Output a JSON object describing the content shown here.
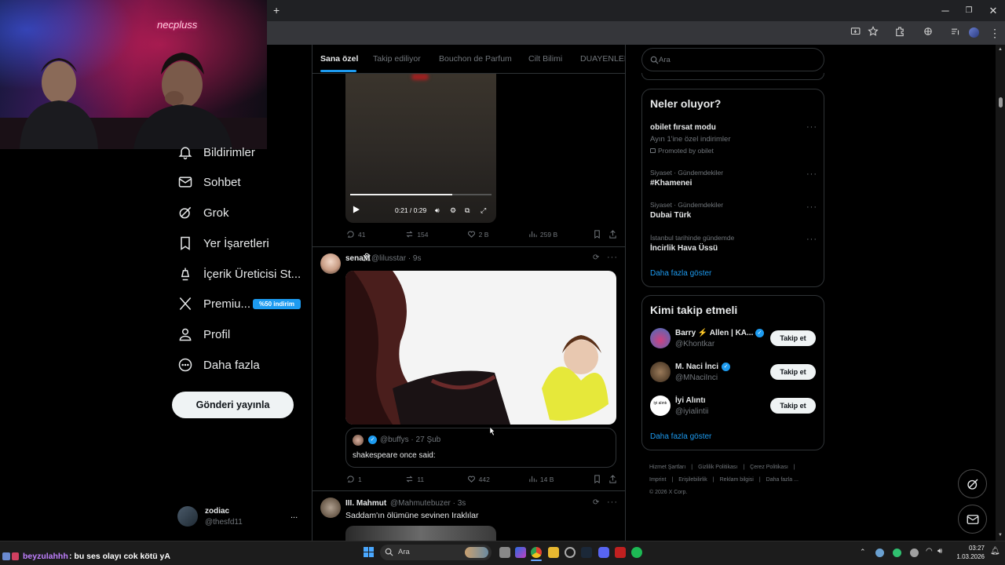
{
  "browser": {
    "new_tab": "+",
    "minimize": "─",
    "restore": "❐",
    "close": "✕"
  },
  "overlay": {
    "logo": "necpluss",
    "chat_user": "beyzulahhh",
    "chat_message": ": bu ses olayı cok kötü yA"
  },
  "sidebar": {
    "items": [
      {
        "label": "Bildirimler",
        "icon": "bell-icon"
      },
      {
        "label": "Sohbet",
        "icon": "mail-icon"
      },
      {
        "label": "Grok",
        "icon": "grok-icon"
      },
      {
        "label": "Yer İşaretleri",
        "icon": "bookmark-icon"
      },
      {
        "label": "İçerik Üreticisi St...",
        "icon": "creator-studio-icon"
      },
      {
        "label": "Premiu...",
        "icon": "x-logo-icon",
        "badge": "%50 indirim"
      },
      {
        "label": "Profil",
        "icon": "person-icon"
      },
      {
        "label": "Daha fazla",
        "icon": "more-circle-icon"
      }
    ],
    "post_button": "Gönderi yayınla",
    "account": {
      "name": "zodiac",
      "handle": "@thesfd11",
      "more": "..."
    }
  },
  "feed": {
    "tabs": [
      "Sana özel",
      "Takip ediliyor",
      "Bouchon de Parfum",
      "Cilt Bilimi",
      "DUAYENLER"
    ],
    "video": {
      "time": "0:21 / 0:29",
      "progress": 0.72
    },
    "post1_stats": {
      "replies": "41",
      "reposts": "154",
      "likes": "2 B",
      "views": "259 B"
    },
    "post2": {
      "name": "sena🕅",
      "handle": "@lilusstar · 9s",
      "quote": {
        "handle": "@buffys · 27 Şub",
        "text": "shakespeare once said:"
      },
      "stats": {
        "replies": "1",
        "reposts": "11",
        "likes": "442",
        "views": "14 B"
      }
    },
    "post3": {
      "name": "III. Mahmut",
      "handle": "@Mahmutebuzer · 3s",
      "text": "Saddam'ın ölümüne sevinen Iraklılar"
    }
  },
  "right": {
    "search_placeholder": "Ara",
    "trends_title": "Neler oluyor?",
    "trends": [
      {
        "category": "",
        "name": "obilet fırsat modu",
        "sub": "Ayın 1'ine özel indirimler",
        "promoted": "Promoted by obilet"
      },
      {
        "category": "Siyaset · Gündemdekiler",
        "name": "#Khamenei"
      },
      {
        "category": "Siyaset · Gündemdekiler",
        "name": "Dubai Türk"
      },
      {
        "category": "İstanbul tarihinde gündemde",
        "name": "İncirlik Hava Üssü"
      }
    ],
    "show_more": "Daha fazla göster",
    "who_title": "Kimi takip etmeli",
    "who": [
      {
        "name": "Barry ⚡ Allen | KA...",
        "handle": "@Khontkar",
        "verified": true,
        "button": "Takip et"
      },
      {
        "name": "M. Naci İnci",
        "handle": "@MNaciInci",
        "verified": true,
        "button": "Takip et"
      },
      {
        "name": "İyi Alıntı",
        "handle": "@iyialintii",
        "verified": false,
        "button": "Takip et",
        "avatar_text": "iyi alıntı"
      }
    ],
    "footer": [
      "Hizmet Şartları",
      "|",
      "Gizlilik Politikası",
      "|",
      "Çerez Politikası",
      "|",
      "Imprint",
      "|",
      "Erişilebilirlik",
      "|",
      "Reklam bilgisi",
      "|",
      "Daha fazla ...",
      "© 2026 X Corp."
    ]
  },
  "taskbar": {
    "search": "Ara",
    "time": "03:27",
    "date": "1.03.2026"
  },
  "colors": {
    "accent": "#1d9bf0",
    "badge": "#1d9bf0",
    "border": "#2f3336",
    "muted": "#71767b"
  }
}
